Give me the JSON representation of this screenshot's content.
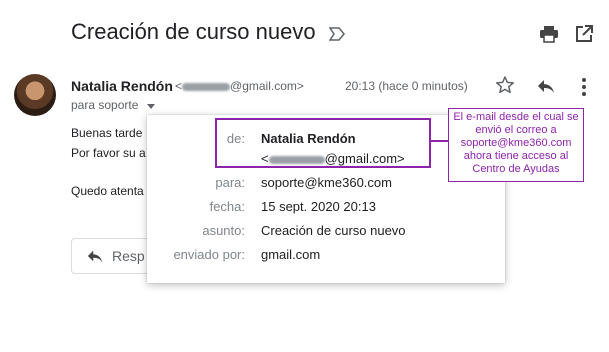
{
  "email": {
    "subject": "Creación de curso nuevo",
    "sender_name": "Natalia Rendón",
    "sender_email_open": "<",
    "sender_email_domain": "@gmail.com>",
    "time": "20:13 (hace 0 minutos)",
    "to_line": "para soporte",
    "body": {
      "line1": "Buenas tarde",
      "line2": "Por favor su a",
      "line3": "Quedo atenta"
    },
    "reply_label": "Resp"
  },
  "details": {
    "from_key": "de:",
    "from_name": "Natalia Rendón",
    "from_email_open": "<",
    "from_email_domain": "@gmail.com>",
    "to_key": "para:",
    "to_value": "soporte@kme360.com",
    "date_key": "fecha:",
    "date_value": "15 sept. 2020 20:13",
    "subject_key": "asunto:",
    "subject_value": "Creación de curso nuevo",
    "sent_by_key": "enviado por:",
    "sent_by_value": "gmail.com"
  },
  "annotation": {
    "text": "El e-mail desde el cual se envió el correo a soporte@kme360.com ahora tiene acceso al Centro de Ayudas",
    "color": "#8e24aa"
  },
  "icons": [
    "label-icon",
    "print-icon",
    "open-in-new-icon",
    "star-icon",
    "reply-icon",
    "more-vert-icon",
    "dropdown-arrow-icon"
  ]
}
